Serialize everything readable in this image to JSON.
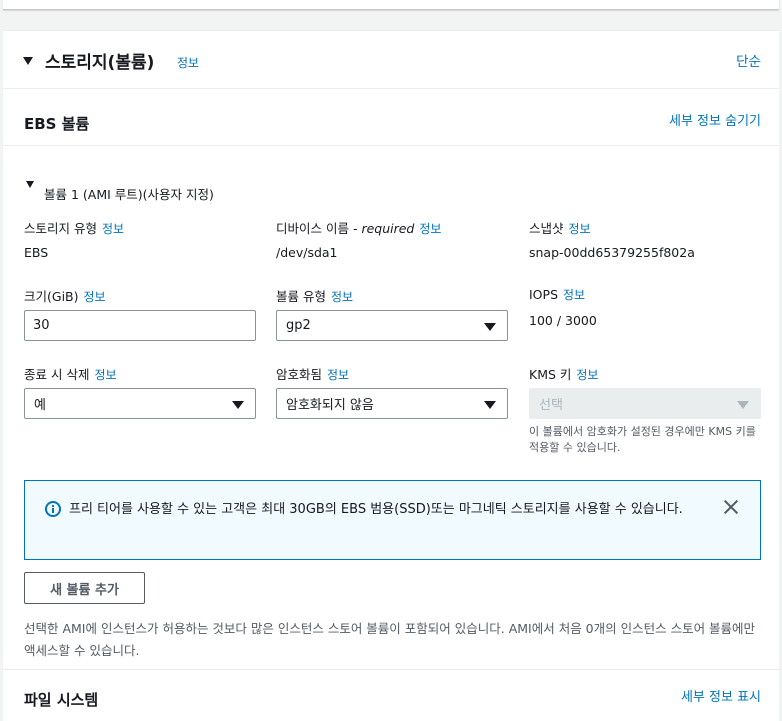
{
  "section": {
    "title": "스토리지(볼륨)",
    "info": "정보",
    "simple": "단순"
  },
  "ebs": {
    "title": "EBS 볼륨",
    "hide_details": "세부 정보 숨기기"
  },
  "volume": {
    "title": "볼륨 1 (AMI 루트)(사용자 지정)",
    "storage_type": {
      "label": "스토리지 유형",
      "info": "정보",
      "value": "EBS"
    },
    "device_name": {
      "label": "디바이스 이름 - ",
      "required": "required",
      "info": "정보",
      "value": "/dev/sda1"
    },
    "snapshot": {
      "label": "스냅샷",
      "info": "정보",
      "value": "snap-00dd65379255f802a"
    },
    "size": {
      "label": "크기(GiB)",
      "info": "정보",
      "value": "30"
    },
    "volume_type": {
      "label": "볼륨 유형",
      "info": "정보",
      "value": "gp2"
    },
    "iops": {
      "label": "IOPS",
      "info": "정보",
      "value": "100 / 3000"
    },
    "delete_on_termination": {
      "label": "종료 시 삭제",
      "info": "정보",
      "value": "예"
    },
    "encrypted": {
      "label": "암호화됨",
      "info": "정보",
      "value": "암호화되지 않음"
    },
    "kms_key": {
      "label": "KMS 키",
      "info": "정보",
      "placeholder": "선택",
      "hint": "이 볼륨에서 암호화가 설정된 경우에만 KMS 키를 적용할 수 있습니다."
    }
  },
  "alert": {
    "message": "프리 티어를 사용할 수 있는 고객은 최대 30GB의 EBS 범용(SSD)또는 마그네틱 스토리지를 사용할 수 있습니다."
  },
  "add_volume_label": "새 볼륨 추가",
  "note": "선택한 AMI에 인스턴스가 허용하는 것보다 많은 인스턴스 스토어 볼륨이 포함되어 있습니다. AMI에서 처음 0개의 인스턴스 스토어 볼륨에만 액세스할 수 있습니다.",
  "filesystem": {
    "title": "파일 시스템",
    "show_details": "세부 정보 표시"
  }
}
